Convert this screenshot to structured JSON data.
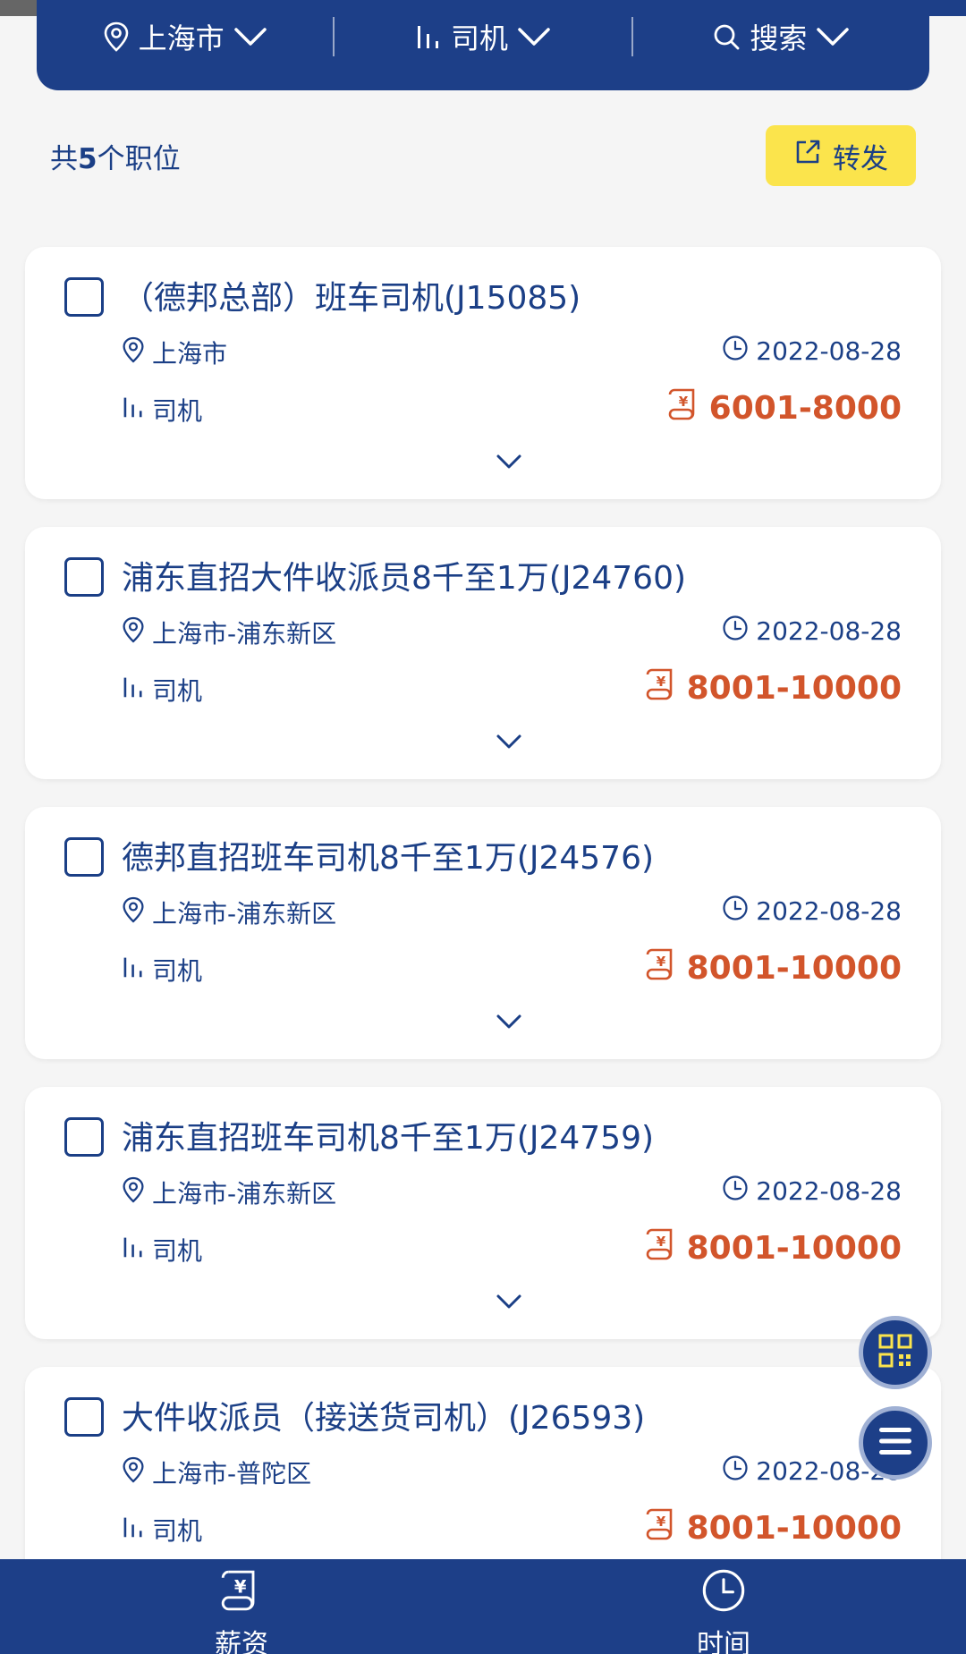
{
  "filters": {
    "city": "上海市",
    "category": "司机",
    "search": "搜索"
  },
  "summary": {
    "prefix": "共",
    "count": "5",
    "suffix": "个职位",
    "share_label": "转发"
  },
  "jobs": [
    {
      "title": "（德邦总部）班车司机(J15085)",
      "location": "上海市",
      "date": "2022-08-28",
      "category": "司机",
      "salary": "6001-8000"
    },
    {
      "title": "浦东直招大件收派员8千至1万(J24760)",
      "location": "上海市-浦东新区",
      "date": "2022-08-28",
      "category": "司机",
      "salary": "8001-10000"
    },
    {
      "title": "德邦直招班车司机8千至1万(J24576)",
      "location": "上海市-浦东新区",
      "date": "2022-08-28",
      "category": "司机",
      "salary": "8001-10000"
    },
    {
      "title": "浦东直招班车司机8千至1万(J24759)",
      "location": "上海市-浦东新区",
      "date": "2022-08-28",
      "category": "司机",
      "salary": "8001-10000"
    },
    {
      "title": "大件收派员（接送货司机）(J26593)",
      "location": "上海市-普陀区",
      "date": "2022-08-28",
      "category": "司机",
      "salary": "8001-10000"
    }
  ],
  "bottom_nav": {
    "salary_label": "薪资",
    "time_label": "时间"
  },
  "colors": {
    "primary": "#1d3f88",
    "accent_yellow": "#fbe44c",
    "salary_red": "#d2552b",
    "background": "#f5f5f5"
  }
}
